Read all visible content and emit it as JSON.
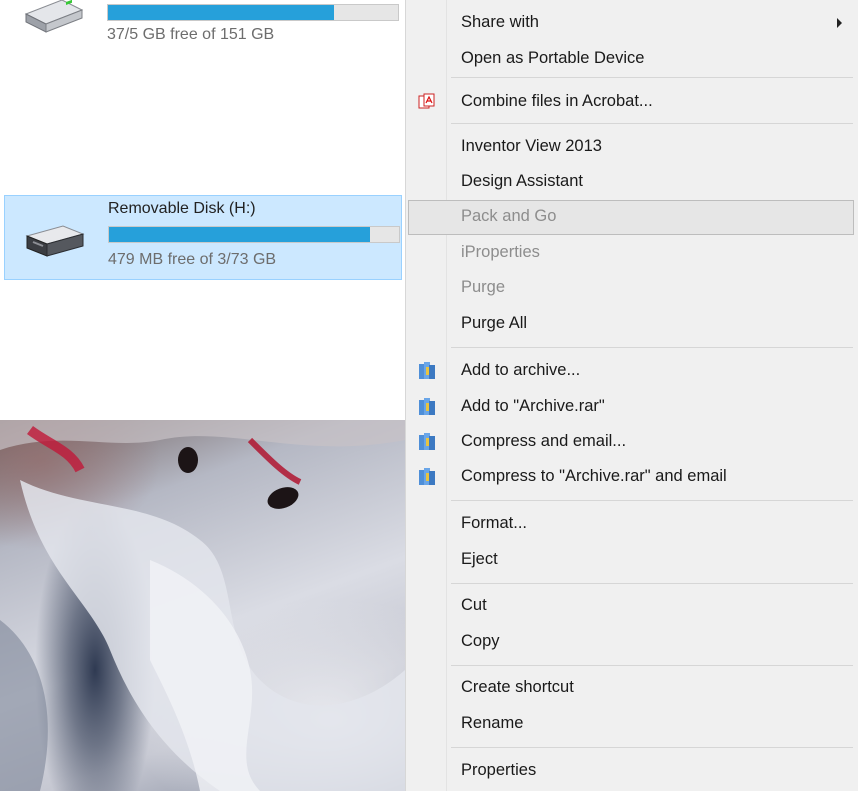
{
  "explorer": {
    "drives": [
      {
        "label": "",
        "free_text": "37/5 GB free of 151 GB",
        "usage_fraction": 0.78
      },
      {
        "label": "Removable Disk (H:)",
        "free_text": "479 MB free of 3/73 GB",
        "usage_fraction": 0.9
      }
    ]
  },
  "menu": {
    "items": [
      {
        "label": "Share with",
        "has_submenu": true
      },
      {
        "label": "Open as Portable Device"
      },
      {
        "label": "Combine files in Acrobat...",
        "icon": "acrobat-icon"
      },
      {
        "label": "Inventor View 2013"
      },
      {
        "label": "Design Assistant"
      },
      {
        "label": "Pack and Go",
        "state": "disabled-highlighted"
      },
      {
        "label": "iProperties",
        "state": "disabled"
      },
      {
        "label": "Purge",
        "state": "disabled"
      },
      {
        "label": "Purge All"
      },
      {
        "label": "Add to archive...",
        "icon": "winrar-icon"
      },
      {
        "label": "Add to \"Archive.rar\"",
        "icon": "winrar-icon"
      },
      {
        "label": "Compress and email...",
        "icon": "winrar-icon"
      },
      {
        "label": "Compress to \"Archive.rar\" and email",
        "icon": "winrar-icon"
      },
      {
        "label": "Format..."
      },
      {
        "label": "Eject"
      },
      {
        "label": "Cut"
      },
      {
        "label": "Copy"
      },
      {
        "label": "Create shortcut"
      },
      {
        "label": "Rename"
      },
      {
        "label": "Properties"
      }
    ]
  },
  "colors": {
    "selection_bg": "#cce8ff",
    "selection_border": "#99d1ff",
    "progress_fill": "#26a0da",
    "menu_bg": "#f0f0f0"
  }
}
